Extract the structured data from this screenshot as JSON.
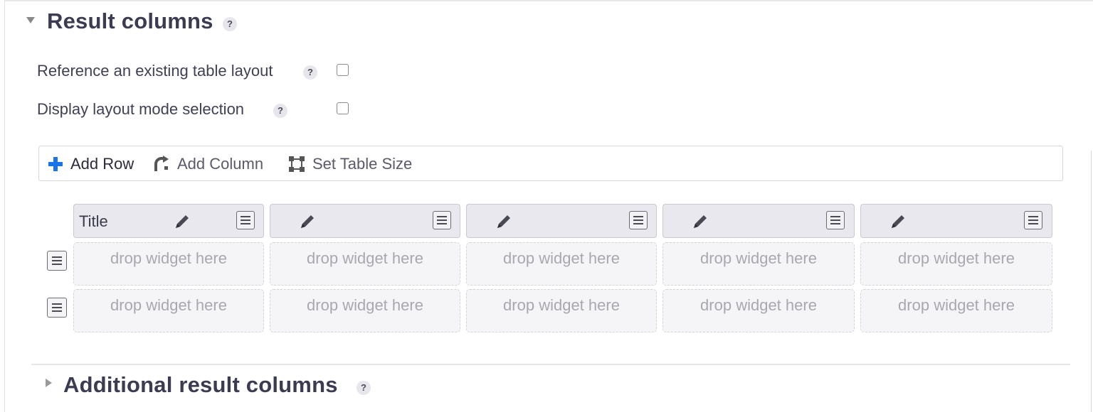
{
  "section": {
    "title": "Result columns",
    "help": "?"
  },
  "options": [
    {
      "label": "Reference an existing table layout",
      "help": "?",
      "checked": false
    },
    {
      "label": "Display layout mode selection",
      "help": "?",
      "checked": false
    }
  ],
  "toolbar": {
    "add_row": "Add Row",
    "add_column": "Add Column",
    "set_table_size": "Set Table Size",
    "accent_color": "#1a73e8"
  },
  "table": {
    "columns": [
      {
        "title": "Title"
      },
      {
        "title": ""
      },
      {
        "title": ""
      },
      {
        "title": ""
      },
      {
        "title": ""
      }
    ],
    "rows": [
      [
        "drop widget here",
        "drop widget here",
        "drop widget here",
        "drop widget here",
        "drop widget here"
      ],
      [
        "drop widget here",
        "drop widget here",
        "drop widget here",
        "drop widget here",
        "drop widget here"
      ]
    ]
  },
  "additional_section": {
    "title": "Additional result columns",
    "help": "?"
  }
}
